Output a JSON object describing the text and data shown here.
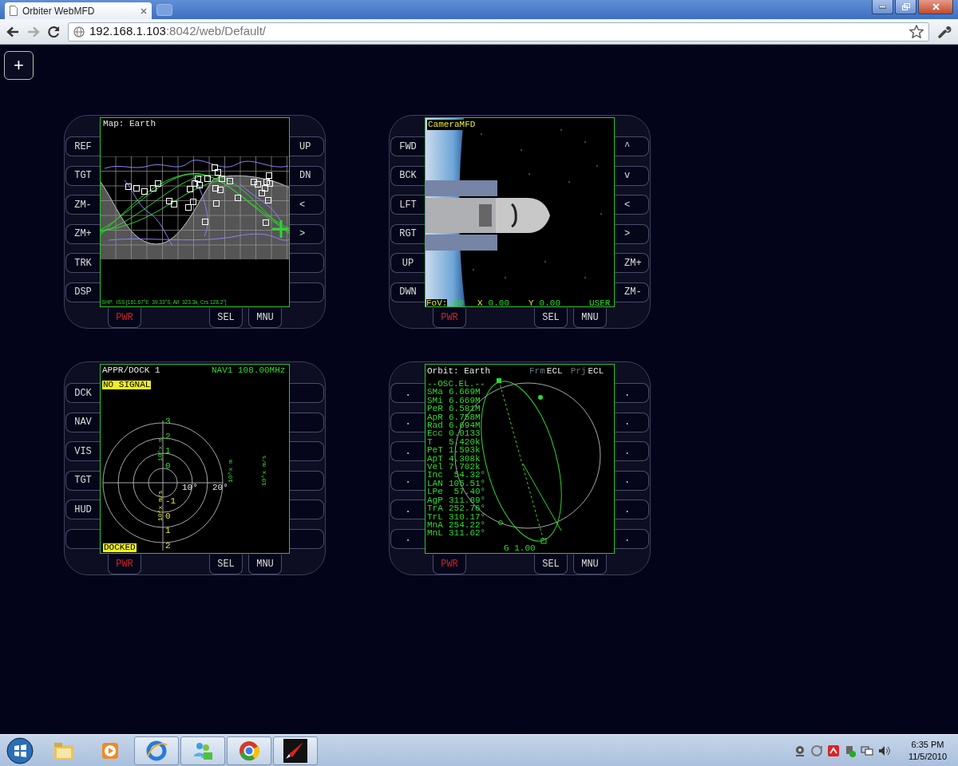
{
  "browser": {
    "tab_title": "Orbiter WebMFD",
    "address_host": "192.168.1.103",
    "address_path": ":8042/web/Default/"
  },
  "add_button": "+",
  "mfds": [
    {
      "kind": "map",
      "title": "Map: Earth",
      "left_buttons": [
        "REF",
        "TGT",
        "ZM-",
        "ZM+",
        "TRK",
        "DSP"
      ],
      "right_buttons": [
        "UP",
        "DN",
        "<",
        ">"
      ],
      "bottom_buttons": [
        "PWR",
        "SEL",
        "MNU"
      ],
      "status": "SHP:  ISS [161.67°E  39.33°S, Alt  323.3k, Crs 128.2°]"
    },
    {
      "kind": "camera",
      "title": "CameraMFD",
      "left_buttons": [
        "FWD",
        "BCK",
        "LFT",
        "RGT",
        "UP",
        "DWN"
      ],
      "right_buttons": [
        "^",
        "v",
        "<",
        ">",
        "ZM+",
        "ZM-"
      ],
      "bottom_buttons": [
        "PWR",
        "SEL",
        "MNU"
      ],
      "readouts": [
        {
          "label": "FoV:",
          "value": "60"
        },
        {
          "label": "X",
          "value": "0.00"
        },
        {
          "label": "Y",
          "value": "0.00"
        }
      ],
      "mode": "USER"
    },
    {
      "kind": "dock",
      "title": "APPR/DOCK 1",
      "nav": "NAV1 108.00MHz",
      "left_buttons": [
        "DCK",
        "NAV",
        "VIS",
        "TGT",
        "HUD"
      ],
      "bottom_buttons": [
        "PWR",
        "SEL",
        "MNU"
      ],
      "signal": "NO SIGNAL",
      "status": "DOCKED",
      "range_ticks": [
        "3",
        "2",
        "1",
        "0"
      ],
      "rate_ticks": [
        "-1",
        "0",
        "1",
        "2"
      ],
      "angle_ticks": [
        "10°",
        "20°"
      ],
      "range_unit": "10^x m",
      "rate_unit": "10^x m/s",
      "bar_units": [
        "10^x m",
        "10^x m/s"
      ]
    },
    {
      "kind": "orbit",
      "title": "Orbit: Earth",
      "frame_label": "Frm",
      "frame_value": "ECL",
      "projection_label": "Prj",
      "projection_value": "ECL",
      "left_buttons": [
        ".",
        ".",
        ".",
        ".",
        ".",
        "."
      ],
      "right_buttons": [
        ".",
        ".",
        ".",
        ".",
        ".",
        "."
      ],
      "bottom_buttons": [
        "PWR",
        "SEL",
        "MNU"
      ],
      "elements_header": "--OSC.EL.--",
      "elements": [
        {
          "label": "SMa",
          "value": "6.669M"
        },
        {
          "label": "SMi",
          "value": "6.669M"
        },
        {
          "label": "PeR",
          "value": "6.581M"
        },
        {
          "label": "ApR",
          "value": "6.758M"
        },
        {
          "label": "Rad",
          "value": "6.694M"
        },
        {
          "label": "Ecc",
          "value": "0.0133"
        },
        {
          "label": "T",
          "value": "5.420k"
        },
        {
          "label": "PeT",
          "value": "1.593k"
        },
        {
          "label": "ApT",
          "value": "4.308k"
        },
        {
          "label": "Vel",
          "value": "7.702k"
        },
        {
          "label": "Inc",
          "value": " 54.32°"
        },
        {
          "label": "LAN",
          "value": "105.51°"
        },
        {
          "label": "LPe",
          "value": " 57.40°"
        },
        {
          "label": "AgP",
          "value": "311.89°"
        },
        {
          "label": "TrA",
          "value": "252.76°"
        },
        {
          "label": "TrL",
          "value": "310.17°"
        },
        {
          "label": "MnA",
          "value": "254.22°"
        },
        {
          "label": "MnL",
          "value": "311.62°"
        }
      ],
      "scale": "G 1.00"
    }
  ],
  "taskbar": {
    "time": "6:35 PM",
    "date": "11/5/2010"
  }
}
